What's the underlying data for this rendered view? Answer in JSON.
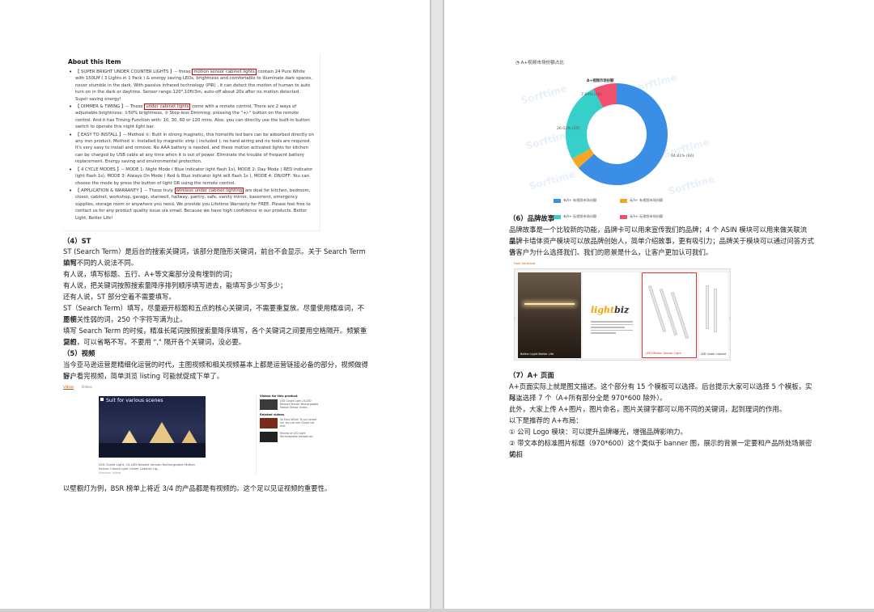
{
  "left_page": {
    "about": {
      "title": "About this item",
      "bullets": [
        {
          "pre": "【 SUPER BRIGHT UNDER COUNTER LIGHTS 】-- these ",
          "hl": "motion sensor cabinet lights",
          "post": " contain 24 Pure White with 150LM ( 3 Lights in 1 Pack ) & energy saving LEDs, brightness and comfortable to illuminate dark spaces, never stumble in the dark. With passive infrared technology (PIR) , it can detect the motion of human to auto turn on in the dark or daytime. Sensor range:120°,10ft/3m, auto-off about 20s after no motion detected. Super saving energy!"
        },
        {
          "pre": "【 DIMMER & TIMING 】-- These ",
          "hl": "under cabinet lights",
          "post": " come with a remote control. There are 2 ways of adjustable brightness: ①50% brightness, ② Step-less Dimming: pressing the \"+/-\" button on the remote control. And it has Timing Function with: 10, 30, 60 or 120 mins. Also, you can directly use the built-in button switch to operate this night light bar."
        },
        {
          "pre": "【 EASY TO INSTALL 】-- Method ①: Built in strong magnetic, this homelife led bars can be adsorbed directly on any iron product. Method ②: Installed by magnetic strip ( included ), no hard wiring and no tools are required. It's very easy to install and remove. No AAA battery is needed, and these motion activated lights for kitchen can be charged by USB cable at any time when it is out of power. Eliminate the trouble of frequent battery replacement. Energy saving and environmental protection.",
          "hl": "",
          "post": ""
        },
        {
          "pre": "【 4 CYCLE MODES 】-- MODE 1: Night Mode ( Blue indicator light flash 1s), MODE 2: Day Mode ( RED indicator light flash 1s), MODE 3: Always On Mode ( Red & Blue indicator light will flash 1s ), MODE 4: ON/OFF: You can choose the mode by press the button of light OR using the remote control.",
          "hl": "",
          "post": ""
        },
        {
          "pre": "【 APPLICATION & WARRANTY 】-- These truly ",
          "hl": "wireless under cabinet lighting",
          "post": " are deal for kitchen, bedroom, closet, cabinet, workshop, garage, stairwell, hallway, pantry, safe, vanity mirror, basement, emergency supplies, storage room or anywhere you need. We provide you Lifetime Warranty for FREE. Please feel free to contact us for any product quality issue via email. Because we have high confidence in our products. Better Light, Better Life!"
        }
      ]
    },
    "st_heading": "（4）ST",
    "st_paragraphs": [
      "ST (Search Term）是后台的搜索关键词，该部分是隐形关键词，前台不会显示。关于 Search Term 如何",
      "填写不同的人说法不同。",
      "有人说，填写标题、五行、A+等文案部分没有埋到的词；",
      "有人说，把关键词按照搜索量降序排列顺序填写进去，能填写多少写多少；",
      "还有人说，ST 部分空着不需要填写。",
      "ST（Search Term）填写，尽量避开标题和五点的核心关键词，不需要重复放。尽量使用精准词，不要使",
      "用相关性弱的词，250 个字符写满为止。",
      "填写 Search Term 的时候，精准长尾词按照搜索量降序填写，各个关键词之间要用空格隔开。频繁重复的",
      "词根，可以省略不写。不要用 \",\" 隔开各个关键词，没必要。"
    ],
    "video_heading": "（5）视频",
    "video_paragraphs": [
      "当今亚马逊运营是精细化运营的时代，主图视频和相关视频基本上都是运营链接必备的部分，视频做得好，",
      "客户看完视频，简单浏览 listing 可能就促成下单了。"
    ],
    "video_shot": {
      "tabs": [
        "Videos",
        "Videos"
      ],
      "main_title": "Suit for various scenes",
      "caption": "LED Closet Light, 24-LED Newest Version Rechargeable Motion Sensor Closet Light Under Cabinet Lig...",
      "caption_sub": "Amazon Video",
      "side_heading_1": "Videos for this product",
      "side_heading_2": "Related videos",
      "side_items": [
        "LED Closet Light 24-LED Newest Version Rechargeable Motion Sensor Under...",
        "So Easy Which To our sensor rim You can see Closet not that",
        "Review of LED Light Rechargeable amazon.ae"
      ]
    },
    "bsr_note": "以壁橱灯为例，BSR 榜单上将近 3/4 的产品都是有视频的。这个足以见证视频的重要性。"
  },
  "right_page": {
    "chart_title": "A+视频市场份额占比",
    "chart_data": {
      "type": "pie",
      "title": "A+视频市场份额",
      "categories": [
        "有A+ 有视频市场份额",
        "无A+ 有视频市场份额",
        "有A+ 无视频市场份额",
        "无A+ 无视频市场份额"
      ],
      "values": [
        64.81,
        3.49,
        26.02,
        7.69
      ],
      "value_labels": [
        "64.81% (60)",
        "3.49% (3)",
        "26.02% (25)",
        "7.69% (10)"
      ],
      "colors": [
        "#3a8ee6",
        "#f5a623",
        "#36cfc9",
        "#f0506e"
      ],
      "legend_position": "bottom"
    },
    "watermark": "Sorftime",
    "brand_heading": "（6）品牌故事",
    "brand_paragraphs": [
      "品牌故事是一个比较新的功能，品牌卡可以用来宣传我们的品牌；4 个 ASIN 模块可以用来做关联流量；",
      "品牌卡墙体资产模块可以放品牌创始人，简单介绍故事，更有吸引力；品牌关于模块可以通过问答方式告",
      "诉客户为什么选择我们、我们的愿景是什么，让客户更加认可我们。"
    ],
    "brand_shot": {
      "label": "From the brand",
      "p1_label": "Better Light Better Life",
      "logo_a": "light",
      "logo_b": "biz",
      "p3_label": "LED Motion Sensor Light",
      "p4_label": "LED Under Cabinet"
    },
    "aplus_heading": "（7）A+ 页面",
    "aplus_paragraphs": [
      "A+页面实际上就是图文描述。这个部分有 15 个模板可以选择。后台提示大家可以选择 5 个模板，实际上",
      "可以选择 7 个（A+所有部分全是 970*600 除外）。",
      "此外，大家上传 A+图片，图片命名，图片关键字都可以用不同的关键词，起到理词的作用。",
      "以下是推荐的 A+布局：",
      "① 公司 Logo 模块：可以提升品牌曝光，增强品牌影响力。",
      "② 带文本的标准图片标题（970*600）这个类似于 banner 图，展示的背景一定要和产品所处场景密切相",
      "关。"
    ]
  }
}
